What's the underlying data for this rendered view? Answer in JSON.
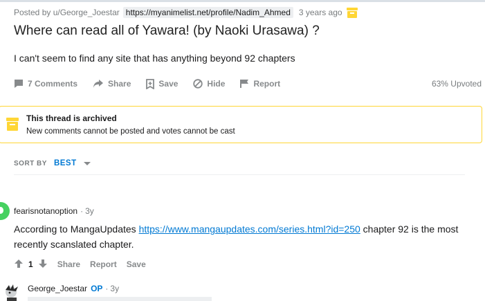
{
  "post": {
    "posted_by": "Posted by u/George_Joestar",
    "flair": "https://myanimelist.net/profile/Nadim_Ahmed",
    "time": "3 years ago",
    "title": "Where can read all of Yawara! (by Naoki Urasawa) ?",
    "body": "I can't seem to find any site that has anything beyond 92 chapters",
    "actions": {
      "comments": "7 Comments",
      "share": "Share",
      "save": "Save",
      "hide": "Hide",
      "report": "Report"
    },
    "upvoted": "63% Upvoted"
  },
  "archived": {
    "title": "This thread is archived",
    "message": "New comments cannot be posted and votes cannot be cast"
  },
  "sort": {
    "label": "SORT BY",
    "value": "BEST"
  },
  "comments": [
    {
      "author": "fearisnotanoption",
      "time": "3y",
      "text_before": "According to MangaUpdates ",
      "link": "https://www.mangaupdates.com/series.html?id=250",
      "text_after": " chapter 92 is the most recently scanslated chapter.",
      "votes": "1",
      "share": "Share",
      "report": "Report",
      "save": "Save"
    },
    {
      "author": "George_Joestar",
      "op_badge": "OP",
      "time": "3y"
    }
  ],
  "colors": {
    "accent": "#0079d3",
    "archive_yellow": "#ffd635",
    "avatar_green": "#46d160",
    "muted": "#878a8c"
  }
}
